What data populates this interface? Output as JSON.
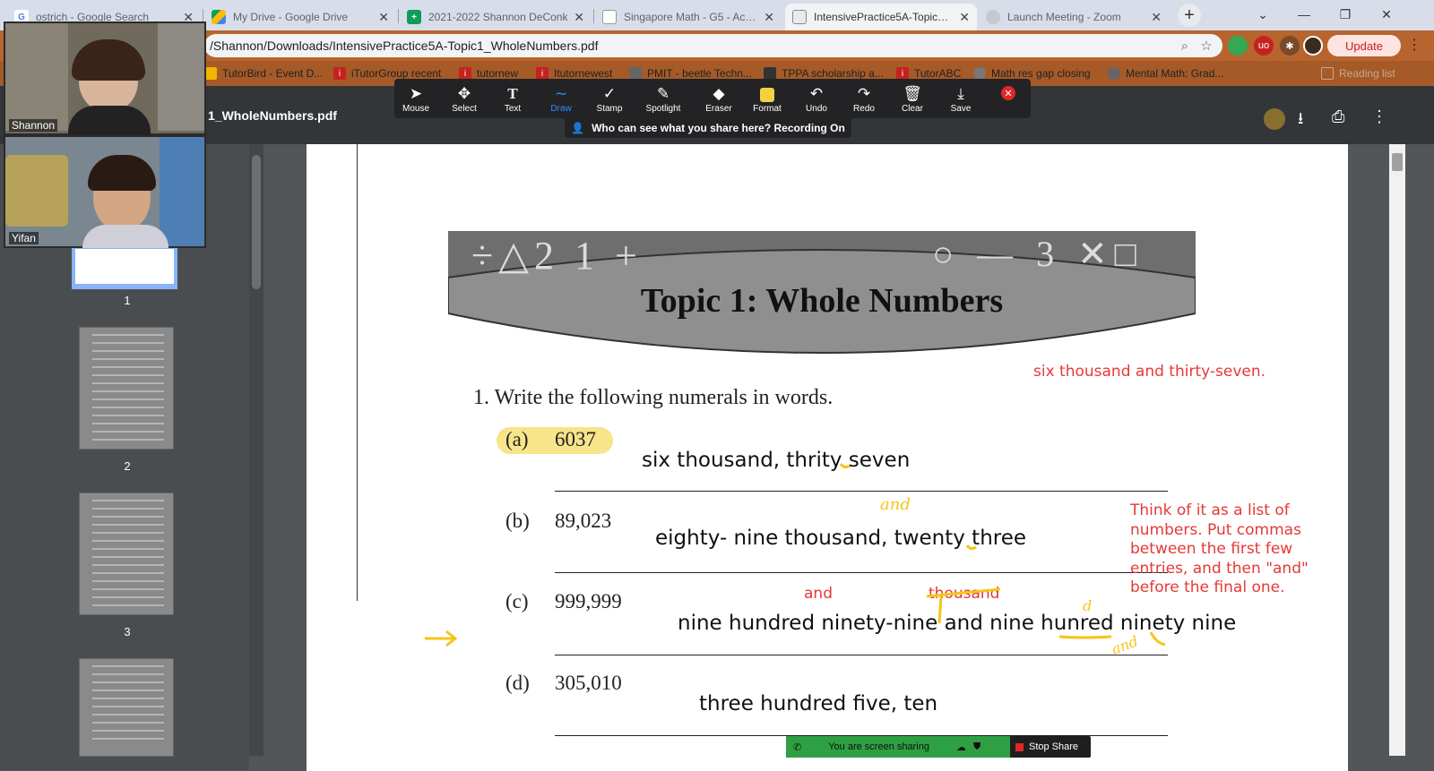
{
  "browser": {
    "tabs": [
      {
        "title": "ostrich - Google Search",
        "icon": "google-icon",
        "icon_letter": "G",
        "color": "#4285f4"
      },
      {
        "title": "My Drive - Google Drive",
        "icon": "drive-icon",
        "icon_letter": "",
        "color": "#fbbc04"
      },
      {
        "title": "2021-2022 Shannon DeConk",
        "icon": "sheets-icon",
        "icon_letter": "+",
        "color": "#0f9d58"
      },
      {
        "title": "Singapore Math - G5 - Acade",
        "icon": "doc-icon",
        "icon_letter": "",
        "color": "#f4b400"
      },
      {
        "title": "IntensivePractice5A-Topic1_W",
        "icon": "pdf-icon",
        "icon_letter": "",
        "color": "#db4437"
      },
      {
        "title": "Launch Meeting - Zoom",
        "icon": "globe-icon",
        "icon_letter": "",
        "color": "#5f6368"
      }
    ],
    "new_tab": "+",
    "url": "/Shannon/Downloads/IntensivePractice5A-Topic1_WholeNumbers.pdf",
    "update_label": "Update",
    "bookmarks": [
      "TutorBird - Event D...",
      "iTutorGroup recent",
      "tutornew",
      "Itutornewest",
      "PMIT - beetle Techn...",
      "TPPA scholarship a...",
      "TutorABC",
      "Math res gap closing",
      "Mental Math: Grad...",
      "Reading list"
    ]
  },
  "pdf": {
    "title": "1_WholeNumbers.pdf",
    "thumbnails": [
      "1",
      "2",
      "3"
    ]
  },
  "zoom": {
    "tools": [
      "Mouse",
      "Select",
      "Text",
      "Draw",
      "Stamp",
      "Spotlight",
      "Eraser",
      "Format",
      "Undo",
      "Redo",
      "Clear",
      "Save"
    ],
    "active_tool": "Draw",
    "sharing_notice": "Who can see what you share here? Recording On",
    "participants": [
      "Shannon",
      "Yifan"
    ],
    "share_status": "You are screen sharing",
    "stop_share": "Stop Share"
  },
  "worksheet": {
    "header_symbols": "÷△2 1 +",
    "header_symbols_right": "○ — 3 ✕□",
    "title": "Topic 1: Whole Numbers",
    "question": "1.   Write the following numerals in words.",
    "items": [
      {
        "label": "(a)",
        "number": "6037",
        "answer": "six thousand, thrity seven"
      },
      {
        "label": "(b)",
        "number": "89,023",
        "answer": "eighty- nine thousand, twenty three"
      },
      {
        "label": "(c)",
        "number": "999,999",
        "answer": "nine hundred ninety-nine and nine hunred ninety nine"
      },
      {
        "label": "(d)",
        "number": "305,010",
        "answer": "three hundred five, ten"
      }
    ]
  },
  "annotations": {
    "red_answer": "six thousand and thirty-seven.",
    "red_note": [
      "Think of it as a list of",
      "numbers.  Put commas",
      "between the first few",
      "entries, and then \"and\"",
      "before the final one."
    ],
    "red_and": "and",
    "red_thousand": "thousand",
    "yellow_and_1": "and",
    "yellow_and_2": "and",
    "yellow_d": "d"
  },
  "colors": {
    "annotation_red": "#e53935",
    "highlighter_yellow": "#f5d142",
    "zoom_green": "#2ea043"
  }
}
